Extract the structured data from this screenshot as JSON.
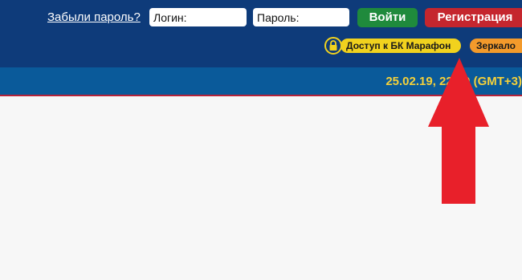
{
  "header": {
    "forgot_password": "Забыли пароль?",
    "login_placeholder": "Логин:",
    "password_placeholder": "Пароль:",
    "login_button": "Войти",
    "register_button": "Регистрация",
    "access_link": "Доступ к БК Марафон",
    "mirror_link": "Зеркало"
  },
  "status_bar": {
    "datetime": "25.02.19, 22:50 (GMT+3)"
  },
  "icons": {
    "lock": "lock-icon",
    "arrow": "arrow-up-icon"
  },
  "colors": {
    "header_bg": "#0e3b7a",
    "status_bg": "#0a5a9a",
    "login_btn": "#1f8a3c",
    "register_btn": "#c5262e",
    "access_pill": "#f1d21e",
    "mirror_pill": "#f39a2b",
    "datetime_text": "#f5d13a",
    "arrow": "#e8202a"
  }
}
